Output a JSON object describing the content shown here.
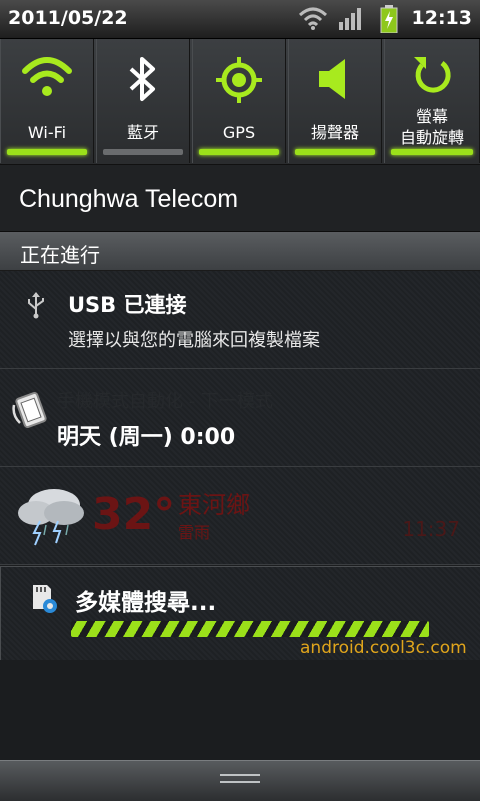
{
  "status_bar": {
    "date": "2011/05/22",
    "time": "12:13",
    "icons": [
      "wifi-icon",
      "signal-icon",
      "battery-charging-icon"
    ]
  },
  "quick_toggles": [
    {
      "label": "Wi-Fi",
      "icon": "wifi-icon",
      "state": "on"
    },
    {
      "label": "藍牙",
      "icon": "bluetooth-icon",
      "state": "off"
    },
    {
      "label": "GPS",
      "icon": "gps-icon",
      "state": "on"
    },
    {
      "label": "揚聲器",
      "icon": "speaker-icon",
      "state": "on"
    },
    {
      "label_line1": "螢幕",
      "label_line2": "自動旋轉",
      "icon": "rotate-icon",
      "state": "on"
    }
  ],
  "carrier": "Chunghwa Telecom",
  "section": "正在進行",
  "notifications": {
    "usb": {
      "title": "USB 已連接",
      "subtitle": "選擇以與您的電腦來回複製檔案",
      "icon": "usb-icon"
    },
    "alarm": {
      "title": "手機模式自動化 - 下一模式",
      "subtitle": "明天 (周一)  0:00",
      "icon": "phone-rotate-icon"
    },
    "weather": {
      "temperature": "32°",
      "location": "東河鄉",
      "condition": "雷雨",
      "updated": "11:37",
      "icon": "thunderstorm-icon"
    },
    "media": {
      "title": "多媒體搜尋...",
      "icon": "sdcard-gear-icon"
    }
  },
  "watermark": "android.cool3c.com",
  "colors": {
    "accent": "#9be01a",
    "weather_text": "#6b1414",
    "watermark": "#e0a51c"
  }
}
